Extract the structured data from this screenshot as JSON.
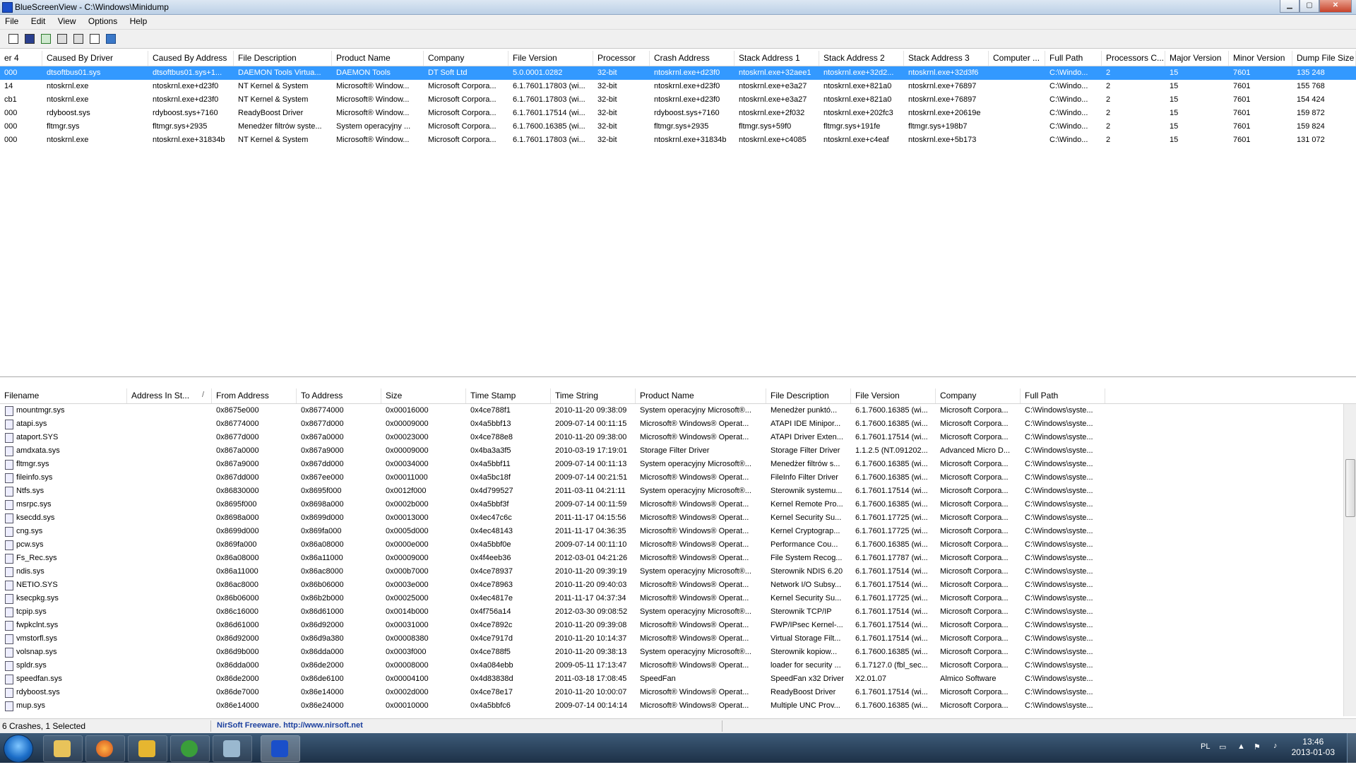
{
  "window": {
    "title": "BlueScreenView  -  C:\\Windows\\Minidump"
  },
  "menu": [
    "File",
    "Edit",
    "View",
    "Options",
    "Help"
  ],
  "top_table": {
    "columns": [
      "er 4",
      "Caused By Driver",
      "Caused By Address",
      "File Description",
      "Product Name",
      "Company",
      "File Version",
      "Processor",
      "Crash Address",
      "Stack Address 1",
      "Stack Address 2",
      "Stack Address 3",
      "Computer ...",
      "Full Path",
      "Processors C...",
      "Major Version",
      "Minor Version",
      "Dump File Size"
    ],
    "rows": [
      [
        "000",
        "dtsoftbus01.sys",
        "dtsoftbus01.sys+1...",
        "DAEMON Tools Virtua...",
        "DAEMON Tools",
        "DT Soft Ltd",
        "5.0.0001.0282",
        "32-bit",
        "ntoskrnl.exe+d23f0",
        "ntoskrnl.exe+32aee1",
        "ntoskrnl.exe+32d2...",
        "ntoskrnl.exe+32d3f6",
        "",
        "C:\\Windo...",
        "2",
        "15",
        "7601",
        "135 248"
      ],
      [
        "14",
        "ntoskrnl.exe",
        "ntoskrnl.exe+d23f0",
        "NT Kernel & System",
        "Microsoft® Window...",
        "Microsoft Corpora...",
        "6.1.7601.17803 (wi...",
        "32-bit",
        "ntoskrnl.exe+d23f0",
        "ntoskrnl.exe+e3a27",
        "ntoskrnl.exe+821a0",
        "ntoskrnl.exe+76897",
        "",
        "C:\\Windo...",
        "2",
        "15",
        "7601",
        "155 768"
      ],
      [
        "cb1",
        "ntoskrnl.exe",
        "ntoskrnl.exe+d23f0",
        "NT Kernel & System",
        "Microsoft® Window...",
        "Microsoft Corpora...",
        "6.1.7601.17803 (wi...",
        "32-bit",
        "ntoskrnl.exe+d23f0",
        "ntoskrnl.exe+e3a27",
        "ntoskrnl.exe+821a0",
        "ntoskrnl.exe+76897",
        "",
        "C:\\Windo...",
        "2",
        "15",
        "7601",
        "154 424"
      ],
      [
        "000",
        "rdyboost.sys",
        "rdyboost.sys+7160",
        "ReadyBoost Driver",
        "Microsoft® Window...",
        "Microsoft Corpora...",
        "6.1.7601.17514 (wi...",
        "32-bit",
        "rdyboost.sys+7160",
        "ntoskrnl.exe+2f032",
        "ntoskrnl.exe+202fc3",
        "ntoskrnl.exe+20619e",
        "",
        "C:\\Windo...",
        "2",
        "15",
        "7601",
        "159 872"
      ],
      [
        "000",
        "fltmgr.sys",
        "fltmgr.sys+2935",
        "Menedżer filtrów syste...",
        "System operacyjny ...",
        "Microsoft Corpora...",
        "6.1.7600.16385 (wi...",
        "32-bit",
        "fltmgr.sys+2935",
        "fltmgr.sys+59f0",
        "fltmgr.sys+191fe",
        "fltmgr.sys+198b7",
        "",
        "C:\\Windo...",
        "2",
        "15",
        "7601",
        "159 824"
      ],
      [
        "000",
        "ntoskrnl.exe",
        "ntoskrnl.exe+31834b",
        "NT Kernel & System",
        "Microsoft® Window...",
        "Microsoft Corpora...",
        "6.1.7601.17803 (wi...",
        "32-bit",
        "ntoskrnl.exe+31834b",
        "ntoskrnl.exe+c4085",
        "ntoskrnl.exe+c4eaf",
        "ntoskrnl.exe+5b173",
        "",
        "C:\\Windo...",
        "2",
        "15",
        "7601",
        "131 072"
      ]
    ]
  },
  "bottom_table": {
    "columns": [
      "Filename",
      "Address In St...",
      "From Address",
      "To Address",
      "Size",
      "Time Stamp",
      "Time String",
      "Product Name",
      "File Description",
      "File Version",
      "Company",
      "Full Path"
    ],
    "sort_marker": "/",
    "rows": [
      [
        "mountmgr.sys",
        "",
        "0x8675e000",
        "0x86774000",
        "0x00016000",
        "0x4ce788f1",
        "2010-11-20 09:38:09",
        "System operacyjny Microsoft®...",
        "Menedżer punktó...",
        "6.1.7600.16385 (wi...",
        "Microsoft Corpora...",
        "C:\\Windows\\syste..."
      ],
      [
        "atapi.sys",
        "",
        "0x86774000",
        "0x8677d000",
        "0x00009000",
        "0x4a5bbf13",
        "2009-07-14 00:11:15",
        "Microsoft® Windows® Operat...",
        "ATAPI IDE Minipor...",
        "6.1.7600.16385 (wi...",
        "Microsoft Corpora...",
        "C:\\Windows\\syste..."
      ],
      [
        "ataport.SYS",
        "",
        "0x8677d000",
        "0x867a0000",
        "0x00023000",
        "0x4ce788e8",
        "2010-11-20 09:38:00",
        "Microsoft® Windows® Operat...",
        "ATAPI Driver Exten...",
        "6.1.7601.17514 (wi...",
        "Microsoft Corpora...",
        "C:\\Windows\\syste..."
      ],
      [
        "amdxata.sys",
        "",
        "0x867a0000",
        "0x867a9000",
        "0x00009000",
        "0x4ba3a3f5",
        "2010-03-19 17:19:01",
        "Storage Filter Driver",
        "Storage Filter Driver",
        "1.1.2.5 (NT.091202...",
        "Advanced Micro D...",
        "C:\\Windows\\syste..."
      ],
      [
        "fltmgr.sys",
        "",
        "0x867a9000",
        "0x867dd000",
        "0x00034000",
        "0x4a5bbf11",
        "2009-07-14 00:11:13",
        "System operacyjny Microsoft®...",
        "Menedżer filtrów s...",
        "6.1.7600.16385 (wi...",
        "Microsoft Corpora...",
        "C:\\Windows\\syste..."
      ],
      [
        "fileinfo.sys",
        "",
        "0x867dd000",
        "0x867ee000",
        "0x00011000",
        "0x4a5bc18f",
        "2009-07-14 00:21:51",
        "Microsoft® Windows® Operat...",
        "FileInfo Filter Driver",
        "6.1.7600.16385 (wi...",
        "Microsoft Corpora...",
        "C:\\Windows\\syste..."
      ],
      [
        "Ntfs.sys",
        "",
        "0x86830000",
        "0x8695f000",
        "0x0012f000",
        "0x4d799527",
        "2011-03-11 04:21:11",
        "System operacyjny Microsoft®...",
        "Sterownik systemu...",
        "6.1.7601.17514 (wi...",
        "Microsoft Corpora...",
        "C:\\Windows\\syste..."
      ],
      [
        "msrpc.sys",
        "",
        "0x8695f000",
        "0x8698a000",
        "0x0002b000",
        "0x4a5bbf3f",
        "2009-07-14 00:11:59",
        "Microsoft® Windows® Operat...",
        "Kernel Remote Pro...",
        "6.1.7600.16385 (wi...",
        "Microsoft Corpora...",
        "C:\\Windows\\syste..."
      ],
      [
        "ksecdd.sys",
        "",
        "0x8698a000",
        "0x8699d000",
        "0x00013000",
        "0x4ec47c6c",
        "2011-11-17 04:15:56",
        "Microsoft® Windows® Operat...",
        "Kernel Security Su...",
        "6.1.7601.17725 (wi...",
        "Microsoft Corpora...",
        "C:\\Windows\\syste..."
      ],
      [
        "cng.sys",
        "",
        "0x8699d000",
        "0x869fa000",
        "0x0005d000",
        "0x4ec48143",
        "2011-11-17 04:36:35",
        "Microsoft® Windows® Operat...",
        "Kernel Cryptograp...",
        "6.1.7601.17725 (wi...",
        "Microsoft Corpora...",
        "C:\\Windows\\syste..."
      ],
      [
        "pcw.sys",
        "",
        "0x869fa000",
        "0x86a08000",
        "0x0000e000",
        "0x4a5bbf0e",
        "2009-07-14 00:11:10",
        "Microsoft® Windows® Operat...",
        "Performance Cou...",
        "6.1.7600.16385 (wi...",
        "Microsoft Corpora...",
        "C:\\Windows\\syste..."
      ],
      [
        "Fs_Rec.sys",
        "",
        "0x86a08000",
        "0x86a11000",
        "0x00009000",
        "0x4f4eeb36",
        "2012-03-01 04:21:26",
        "Microsoft® Windows® Operat...",
        "File System Recog...",
        "6.1.7601.17787 (wi...",
        "Microsoft Corpora...",
        "C:\\Windows\\syste..."
      ],
      [
        "ndis.sys",
        "",
        "0x86a11000",
        "0x86ac8000",
        "0x000b7000",
        "0x4ce78937",
        "2010-11-20 09:39:19",
        "System operacyjny Microsoft®...",
        "Sterownik NDIS 6.20",
        "6.1.7601.17514 (wi...",
        "Microsoft Corpora...",
        "C:\\Windows\\syste..."
      ],
      [
        "NETIO.SYS",
        "",
        "0x86ac8000",
        "0x86b06000",
        "0x0003e000",
        "0x4ce78963",
        "2010-11-20 09:40:03",
        "Microsoft® Windows® Operat...",
        "Network I/O Subsy...",
        "6.1.7601.17514 (wi...",
        "Microsoft Corpora...",
        "C:\\Windows\\syste..."
      ],
      [
        "ksecpkg.sys",
        "",
        "0x86b06000",
        "0x86b2b000",
        "0x00025000",
        "0x4ec4817e",
        "2011-11-17 04:37:34",
        "Microsoft® Windows® Operat...",
        "Kernel Security Su...",
        "6.1.7601.17725 (wi...",
        "Microsoft Corpora...",
        "C:\\Windows\\syste..."
      ],
      [
        "tcpip.sys",
        "",
        "0x86c16000",
        "0x86d61000",
        "0x0014b000",
        "0x4f756a14",
        "2012-03-30 09:08:52",
        "System operacyjny Microsoft®...",
        "Sterownik TCP/IP",
        "6.1.7601.17514 (wi...",
        "Microsoft Corpora...",
        "C:\\Windows\\syste..."
      ],
      [
        "fwpkclnt.sys",
        "",
        "0x86d61000",
        "0x86d92000",
        "0x00031000",
        "0x4ce7892c",
        "2010-11-20 09:39:08",
        "Microsoft® Windows® Operat...",
        "FWP/IPsec Kernel-...",
        "6.1.7601.17514 (wi...",
        "Microsoft Corpora...",
        "C:\\Windows\\syste..."
      ],
      [
        "vmstorfl.sys",
        "",
        "0x86d92000",
        "0x86d9a380",
        "0x00008380",
        "0x4ce7917d",
        "2010-11-20 10:14:37",
        "Microsoft® Windows® Operat...",
        "Virtual Storage Filt...",
        "6.1.7601.17514 (wi...",
        "Microsoft Corpora...",
        "C:\\Windows\\syste..."
      ],
      [
        "volsnap.sys",
        "",
        "0x86d9b000",
        "0x86dda000",
        "0x0003f000",
        "0x4ce788f5",
        "2010-11-20 09:38:13",
        "System operacyjny Microsoft®...",
        "Sterownik kopiow...",
        "6.1.7600.16385 (wi...",
        "Microsoft Corpora...",
        "C:\\Windows\\syste..."
      ],
      [
        "spldr.sys",
        "",
        "0x86dda000",
        "0x86de2000",
        "0x00008000",
        "0x4a084ebb",
        "2009-05-11 17:13:47",
        "Microsoft® Windows® Operat...",
        "loader for security ...",
        "6.1.7127.0 (fbl_sec...",
        "Microsoft Corpora...",
        "C:\\Windows\\syste..."
      ],
      [
        "speedfan.sys",
        "",
        "0x86de2000",
        "0x86de6100",
        "0x00004100",
        "0x4d83838d",
        "2011-03-18 17:08:45",
        "SpeedFan",
        "SpeedFan x32 Driver",
        "X2.01.07",
        "Almico Software",
        "C:\\Windows\\syste..."
      ],
      [
        "rdyboost.sys",
        "",
        "0x86de7000",
        "0x86e14000",
        "0x0002d000",
        "0x4ce78e17",
        "2010-11-20 10:00:07",
        "Microsoft® Windows® Operat...",
        "ReadyBoost Driver",
        "6.1.7601.17514 (wi...",
        "Microsoft Corpora...",
        "C:\\Windows\\syste..."
      ],
      [
        "mup.sys",
        "",
        "0x86e14000",
        "0x86e24000",
        "0x00010000",
        "0x4a5bbfc6",
        "2009-07-14 00:14:14",
        "Microsoft® Windows® Operat...",
        "Multiple UNC Prov...",
        "6.1.7600.16385 (wi...",
        "Microsoft Corpora...",
        "C:\\Windows\\syste..."
      ]
    ]
  },
  "status": {
    "crashes": "6 Crashes, 1 Selected",
    "freeware": "NirSoft Freeware.  http://www.nirsoft.net"
  },
  "taskbar": {
    "language": "PL",
    "time": "13:46",
    "date": "2013-01-03"
  },
  "colors": {
    "selection": "#3399ff",
    "link": "#1b3f9e"
  }
}
